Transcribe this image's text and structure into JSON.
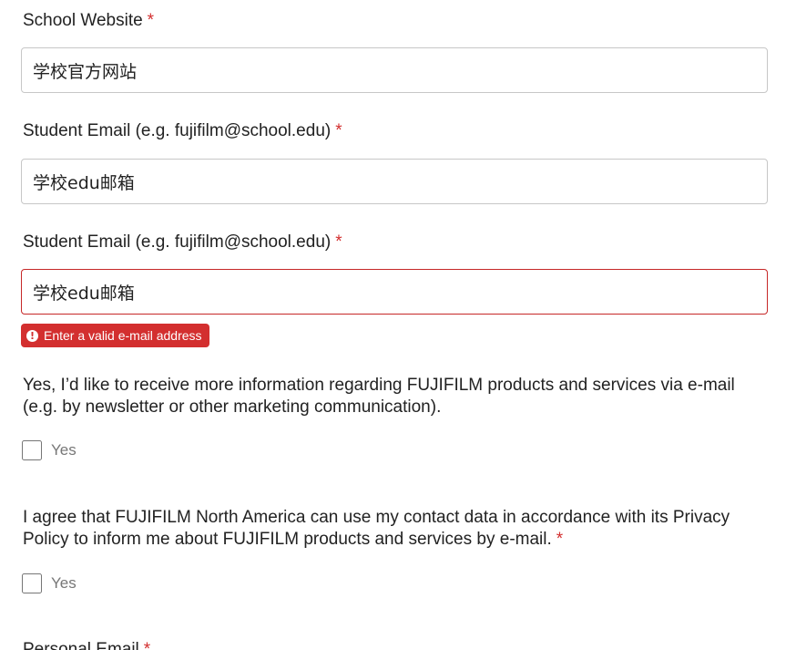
{
  "form": {
    "school_website": {
      "label": "School Website",
      "required_mark": "*",
      "value": "学校官方网站"
    },
    "student_email_1": {
      "label": "Student Email (e.g. fujifilm@school.edu)",
      "required_mark": "*",
      "value": "学校edu邮箱"
    },
    "student_email_2": {
      "label": "Student Email (e.g. fujifilm@school.edu)",
      "required_mark": "*",
      "value": "学校edu邮箱",
      "error": "Enter a valid e-mail address",
      "error_icon": "!"
    },
    "newsletter_optin": {
      "question": "Yes, I’d like to receive more information regarding FUJIFILM products and services via e-mail  (e.g. by newsletter or other marketing communication).",
      "option_label": "Yes",
      "checked": false
    },
    "privacy_consent": {
      "question": "I agree that FUJIFILM North America can use my contact data in accordance with its Privacy Policy to inform me about FUJIFILM products and services by e-mail.",
      "required_mark": "*",
      "option_label": "Yes",
      "checked": false
    },
    "personal_email": {
      "label": "Personal Email",
      "required_mark": "*"
    }
  },
  "colors": {
    "required": "#d32f2f",
    "error_bg": "#d32f2f",
    "error_border": "#c62828",
    "input_border": "#c7c7c7"
  }
}
